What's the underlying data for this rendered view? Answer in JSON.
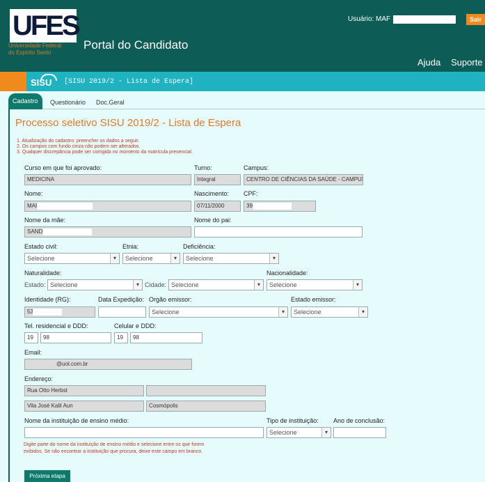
{
  "header": {
    "logo_text": "UFES",
    "logo_subtitle_1": "Universidade Federal",
    "logo_subtitle_2": "do Espírito Santo",
    "portal_title": "Portal do Candidato",
    "user_label": "Usuário: MAF",
    "logout_label": "Sair",
    "nav": {
      "help": "Ajuda",
      "support": "Suporte"
    }
  },
  "bar": {
    "logo": "SISU",
    "title": "[SISU 2019/2 - Lista de Espera]"
  },
  "tabs": [
    "Cadastro",
    "Questionário",
    "Doc.Geral"
  ],
  "form": {
    "title": "Processo seletivo SISU 2019/2 - Lista de Espera",
    "notes": [
      "1. Atualização do cadastro: preencher os dados a seguir.",
      "2. Os campos com fundo cinza não podem ser alterados.",
      "3. Qualquer discrepância pode ser corrigida no momento da matrícula presencial."
    ],
    "labels": {
      "course": "Curso em que foi aprovado:",
      "shift": "Turno:",
      "campus": "Campus:",
      "name": "Nome:",
      "birth": "Nascimento:",
      "cpf": "CPF:",
      "mother": "Nome da mãe:",
      "father": "Nome do pai:",
      "civil_status": "Estado civil:",
      "ethnicity": "Etnia:",
      "disability": "Deficiência:",
      "birthplace": "Naturalidade:",
      "state": "Estado:",
      "city": "Cidade:",
      "nationality": "Nacionalidade:",
      "identity": "Identidade (RG):",
      "issue_date": "Data Expedição:",
      "issuer": "Orgão emissor:",
      "issuer_state": "Estado emissor:",
      "phone": "Tel. residencial e DDD:",
      "mobile": "Celular e DDD:",
      "email": "Email:",
      "address": "Endereço:",
      "school": "Nome da instituição de ensino médio:",
      "school_type": "Tipo de instituição:",
      "grad_year": "Ano de conclusão:"
    },
    "values": {
      "course": "MEDICINA",
      "shift": "Integral",
      "campus": "CENTRO DE CIÊNCIAS DA SAÚDE - CAMPUS",
      "name": "MAF",
      "birth": "07/11/2000",
      "cpf": "39",
      "mother": "SANDI",
      "identity": "53",
      "phone_ddd": "19",
      "phone_num": "98",
      "mobile_ddd": "19",
      "mobile_num": "98",
      "email": "@uol.com.br",
      "street": "Rua Otto Herbst",
      "district": "Vila José Kalil Aun",
      "city_addr": "Cosmópolis"
    },
    "select_placeholder": "Selecione",
    "hint": [
      "Digite parte do nome da instituição de ensino médio e selecione entre os que forem",
      "exibidos. Se não encontrar a instituição que procura, deixe este campo em branco."
    ],
    "next_button": "Próxima etapa"
  }
}
